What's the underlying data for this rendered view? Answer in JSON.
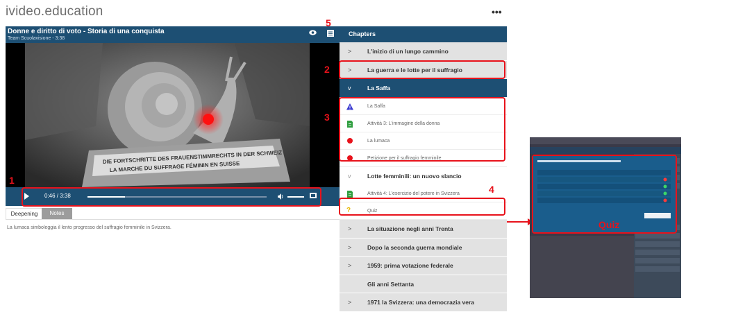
{
  "app": {
    "logo_text": "ivideo.education",
    "more_label": "•••"
  },
  "video": {
    "title": "Donne e diritto di voto - Storia di una conquista",
    "subtitle": "Team Scuolavisione - 3:38",
    "time_display": "0:46 / 3:38",
    "progress_fraction": 0.21,
    "banner_line1": "DIE FORTSCHRITTE DES FRAUENSTIMMRECHTS IN DER SCHWEIZ",
    "banner_line2": "LA MARCHE DU SUFFRAGE FÉMININ EN SUISSE"
  },
  "tabs": [
    {
      "label": "Deepening",
      "active": true
    },
    {
      "label": "Notes",
      "active": false
    }
  ],
  "description": "La lumaca simboleggia il lento progresso del suffragio femminile in Svizzera.",
  "chapters_header": "Chapters",
  "chapter_rows": [
    {
      "label": "L'inizio di un lungo cammino",
      "chev": ">"
    },
    {
      "label": "La guerra e le lotte per il suffragio",
      "chev": ">"
    },
    {
      "label": "La Saffa",
      "chev": "v"
    },
    {
      "label": "La Saffa",
      "icon": "warning-icon"
    },
    {
      "label": "Attività 3: L'immagine della donna",
      "icon": "document-icon"
    },
    {
      "label": "La lumaca",
      "icon": "red-dot-icon"
    },
    {
      "label": "Petizione per il suffragio femminile",
      "icon": "red-dot-icon"
    },
    {
      "label": "Lotte femminili: un nuovo slancio",
      "chev": "v"
    },
    {
      "label": "Attività 4: L'esercizio del potere in Svizzera",
      "icon": "document-icon"
    },
    {
      "label": "Quiz",
      "icon": "question-icon"
    },
    {
      "label": "La situazione negli anni Trenta",
      "chev": ">"
    },
    {
      "label": "Dopo la seconda guerra mondiale",
      "chev": ">"
    },
    {
      "label": "1959: prima votazione federale",
      "chev": ">"
    },
    {
      "label": "Gli anni Settanta",
      "chev": ""
    },
    {
      "label": "1971 la Svizzera: una democrazia vera",
      "chev": ">"
    }
  ],
  "annotations": {
    "n1": "1",
    "n2": "2",
    "n3": "3",
    "n4": "4",
    "n5": "5"
  },
  "quiz_preview": {
    "label": "Quiz"
  },
  "colors": {
    "header_blue": "#1d4f73",
    "annotation_red": "#e8121b"
  }
}
